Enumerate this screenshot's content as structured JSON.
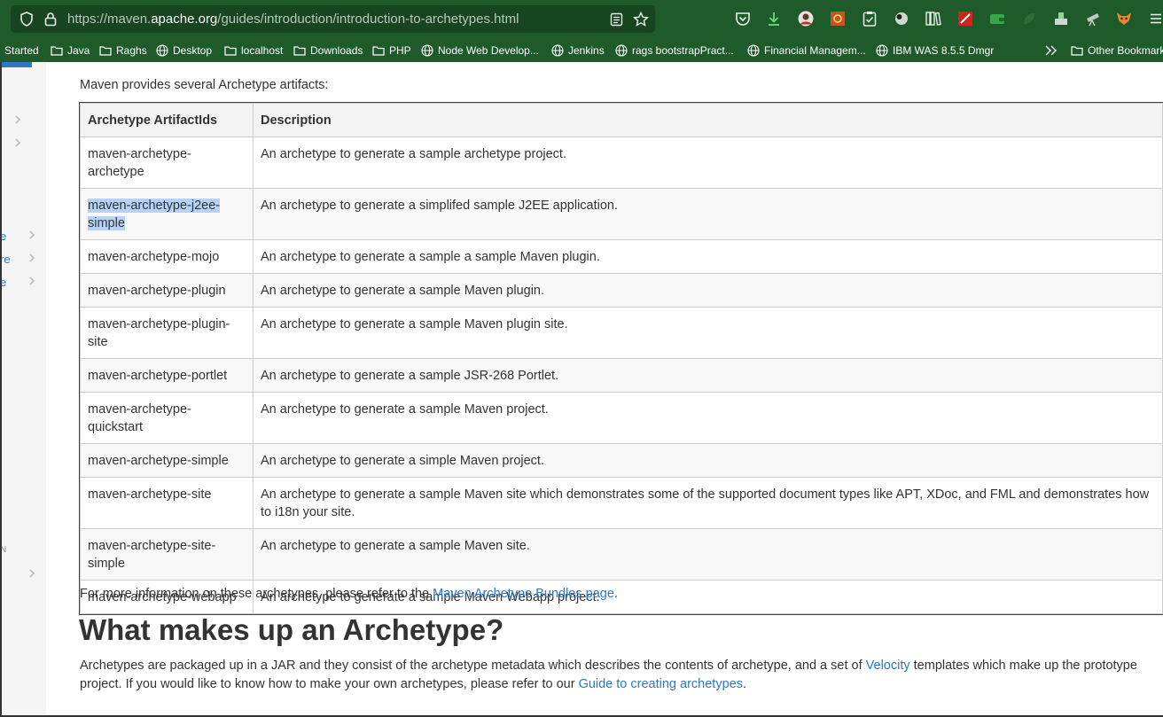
{
  "browser": {
    "url_prefix": "https://maven.",
    "url_domain": "apache.org",
    "url_path": "/guides/introduction/introduction-to-archetypes.html",
    "bookmarks": [
      {
        "label": "Started",
        "icon": "none"
      },
      {
        "label": "Java",
        "icon": "folder-icon"
      },
      {
        "label": "Raghs",
        "icon": "folder-icon"
      },
      {
        "label": "Desktop",
        "icon": "globe-icon"
      },
      {
        "label": "localhost",
        "icon": "folder-icon"
      },
      {
        "label": "Downloads",
        "icon": "folder-icon"
      },
      {
        "label": "PHP",
        "icon": "folder-icon"
      },
      {
        "label": "Node Web Develop...",
        "icon": "globe-icon"
      },
      {
        "label": "Jenkins",
        "icon": "globe-icon"
      },
      {
        "label": "rags bootstrapPract...",
        "icon": "globe-icon"
      },
      {
        "label": "Financial Managem...",
        "icon": "globe-icon"
      },
      {
        "label": "IBM WAS 8.5.5 Dmgr",
        "icon": "globe-icon"
      },
      {
        "label": "Other Bookmarks",
        "icon": "folder-icon"
      }
    ],
    "extension_icons": [
      "pocket-icon",
      "download-icon",
      "profile-icon",
      "extension-icon",
      "clipboard-icon",
      "puzzle-icon",
      "library-icon",
      "tool-icon",
      "wallet-icon",
      "leaf-icon",
      "inbox-icon",
      "telescope-icon",
      "fox-icon",
      "menu-icon"
    ]
  },
  "sidebar": {
    "fragments": [
      "e",
      "re",
      "e",
      "N"
    ]
  },
  "content": {
    "intro": "Maven provides several Archetype artifacts:",
    "table": {
      "headers": [
        "Archetype ArtifactIds",
        "Description"
      ],
      "rows": [
        [
          "maven-archetype-archetype",
          "An archetype to generate a sample archetype project."
        ],
        [
          "maven-archetype-j2ee-simple",
          "An archetype to generate a simplifed sample J2EE application."
        ],
        [
          "maven-archetype-mojo",
          "An archetype to generate a sample a sample Maven plugin."
        ],
        [
          "maven-archetype-plugin",
          "An archetype to generate a sample Maven plugin."
        ],
        [
          "maven-archetype-plugin-site",
          "An archetype to generate a sample Maven plugin site."
        ],
        [
          "maven-archetype-portlet",
          "An archetype to generate a sample JSR-268 Portlet."
        ],
        [
          "maven-archetype-quickstart",
          "An archetype to generate a sample Maven project."
        ],
        [
          "maven-archetype-simple",
          "An archetype to generate a simple Maven project."
        ],
        [
          "maven-archetype-site",
          "An archetype to generate a sample Maven site which demonstrates some of the supported document types like APT, XDoc, and FML and demonstrates how to i18n your site."
        ],
        [
          "maven-archetype-site-simple",
          "An archetype to generate a sample Maven site."
        ],
        [
          "maven-archetype-webapp",
          "An archetype to generate a sample Maven Webapp project."
        ]
      ],
      "selected_row_index": 1
    },
    "more_info_prefix": "For more information on these archetypes, please refer to the ",
    "more_info_link": "Maven Archetype Bundles page",
    "more_info_suffix": ".",
    "heading": "What makes up an Archetype?",
    "para_part1": "Archetypes are packaged up in a JAR and they consist of the archetype metadata which describes the contents of archetype, and a set of ",
    "para_link1": "Velocity",
    "para_part2": " templates which make up the prototype project. If you would like to know how to make your own archetypes, please refer to our ",
    "para_link2": "Guide to creating archetypes",
    "para_part3": "."
  },
  "colors": {
    "toolbar_bg": "#1f5a2a",
    "link": "#2b78c5",
    "selection": "#b6d3f7"
  }
}
